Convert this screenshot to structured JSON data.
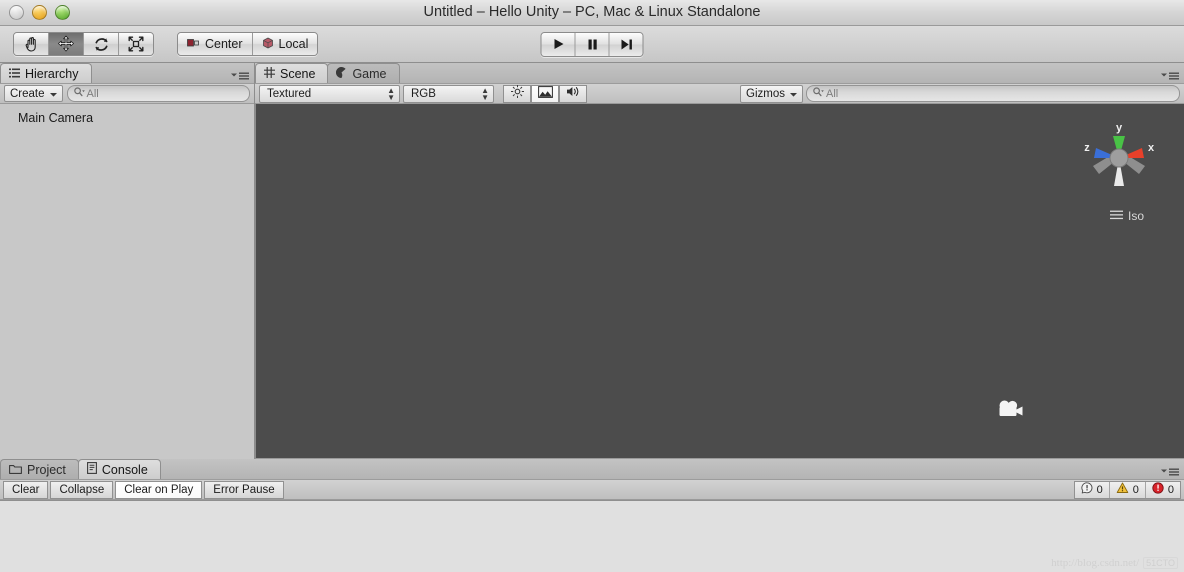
{
  "window": {
    "title": "Untitled – Hello Unity – PC, Mac & Linux Standalone",
    "controls": {
      "close": "close",
      "minimize": "minimize",
      "zoom": "zoom"
    }
  },
  "toolbar": {
    "tools": [
      {
        "name": "hand-tool",
        "label": "Hand",
        "active": false
      },
      {
        "name": "move-tool",
        "label": "Move",
        "active": true
      },
      {
        "name": "rotate-tool",
        "label": "Rotate",
        "active": false
      },
      {
        "name": "scale-tool",
        "label": "Scale",
        "active": false
      }
    ],
    "pivot_mode": "Center",
    "pivot_rotation": "Local",
    "playback": [
      {
        "name": "play-button",
        "label": "Play"
      },
      {
        "name": "pause-button",
        "label": "Pause"
      },
      {
        "name": "step-button",
        "label": "Step"
      }
    ]
  },
  "hierarchy": {
    "tab_label": "Hierarchy",
    "create_label": "Create",
    "search_placeholder": "All",
    "items": [
      {
        "label": "Main Camera"
      }
    ]
  },
  "scene": {
    "tabs": [
      {
        "label": "Scene",
        "active": true
      },
      {
        "label": "Game",
        "active": false
      }
    ],
    "draw_mode": "Textured",
    "color_mode": "RGB",
    "toggles": [
      {
        "name": "lighting-toggle",
        "label": "Lighting",
        "on": false
      },
      {
        "name": "skybox-toggle",
        "label": "Skybox / Image Effects",
        "on": true
      },
      {
        "name": "audio-toggle",
        "label": "Audio",
        "on": false
      }
    ],
    "gizmos_label": "Gizmos",
    "search_placeholder": "All",
    "view_mode_label": "Iso",
    "axes": [
      {
        "name": "y-axis",
        "label": "y",
        "color": "#49c246"
      },
      {
        "name": "x-axis",
        "label": "x",
        "color": "#e8402a"
      },
      {
        "name": "z-axis",
        "label": "z",
        "color": "#3a6fd8"
      }
    ],
    "background_color": "#4c4c4c",
    "scene_objects": [
      {
        "name": "camera-gizmo",
        "label": "Main Camera"
      }
    ]
  },
  "bottom": {
    "tabs": [
      {
        "label": "Project",
        "active": false
      },
      {
        "label": "Console",
        "active": true
      }
    ],
    "buttons": [
      {
        "name": "clear-button",
        "label": "Clear",
        "on": false
      },
      {
        "name": "collapse-button",
        "label": "Collapse",
        "on": false
      },
      {
        "name": "clear-on-play-button",
        "label": "Clear on Play",
        "on": true
      },
      {
        "name": "error-pause-button",
        "label": "Error Pause",
        "on": false
      }
    ],
    "counters": [
      {
        "name": "log-count",
        "type": "info",
        "value": "0"
      },
      {
        "name": "warning-count",
        "type": "warning",
        "value": "0"
      },
      {
        "name": "error-count",
        "type": "error",
        "value": "0"
      }
    ],
    "messages": []
  },
  "watermark": {
    "url": "http://blog.csdn.net/",
    "badge": "51CTO"
  }
}
